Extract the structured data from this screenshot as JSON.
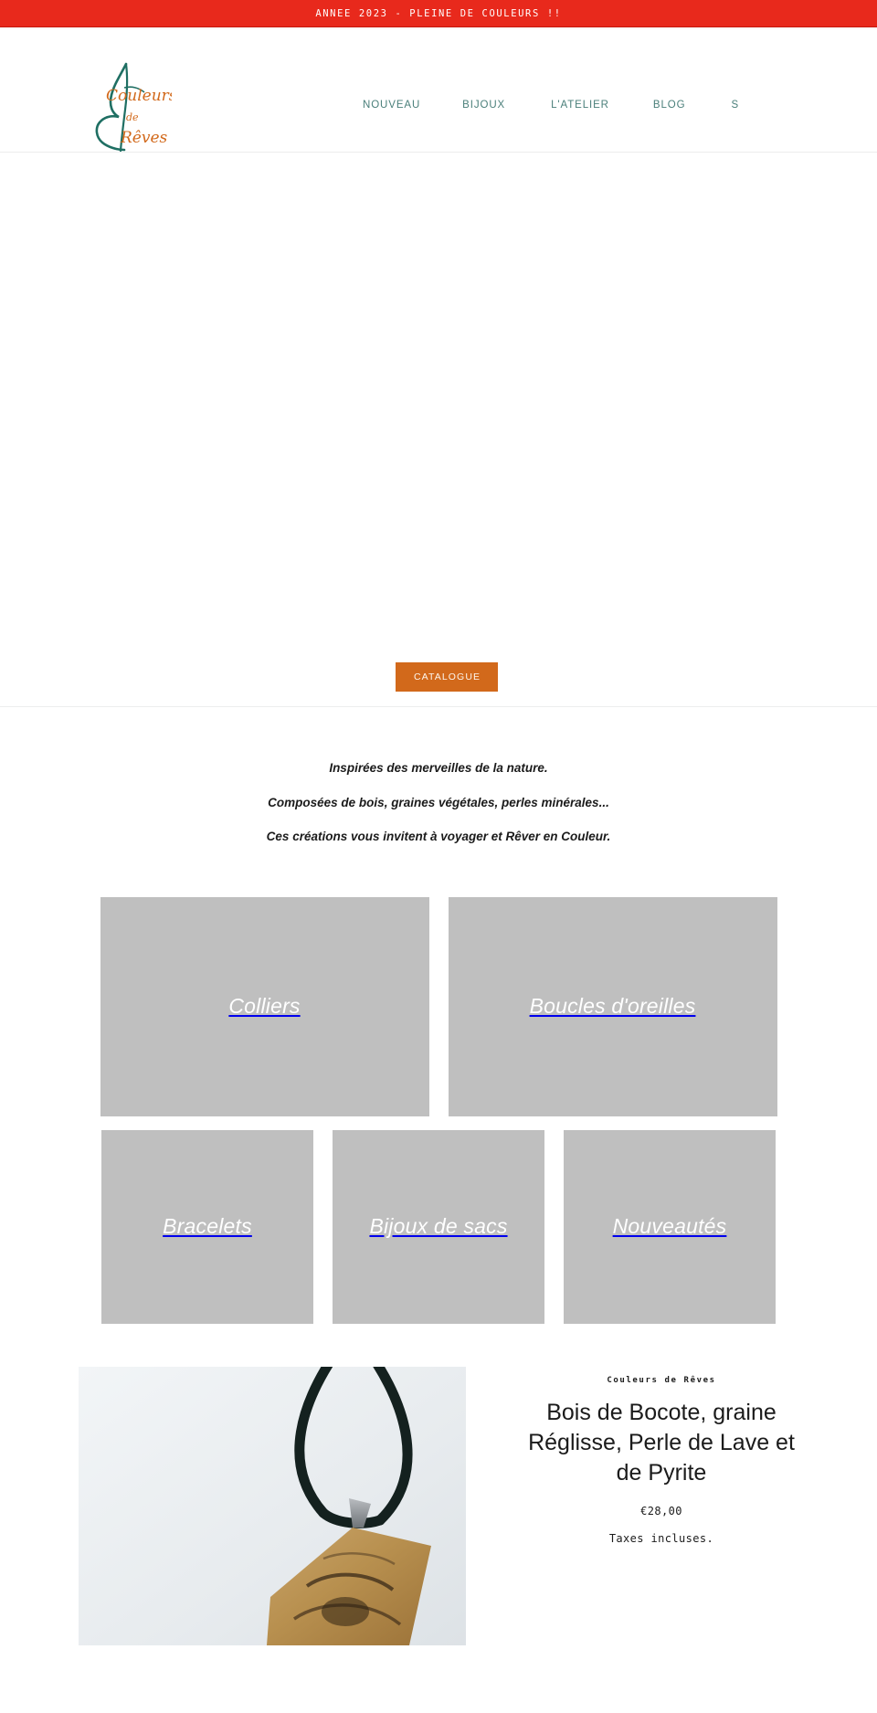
{
  "announcement": {
    "text": "ANNEE 2023 - PLEINE DE COULEURS !!",
    "background": "#e8291c",
    "color": "#ffffff"
  },
  "header": {
    "logo": {
      "name": "couleurs-de-reves-logo",
      "line1": "Couleurs",
      "line2": "de",
      "line3": "Rêves",
      "script_color": "#d2691b",
      "leaf_color": "#1f6f63"
    },
    "nav": {
      "color": "#4a7f7a",
      "items": [
        {
          "label": "NOUVEAU",
          "name": "nav-nouveau"
        },
        {
          "label": "BIJOUX",
          "name": "nav-bijoux"
        },
        {
          "label": "L'ATELIER",
          "name": "nav-atelier"
        },
        {
          "label": "BLOG",
          "name": "nav-blog"
        },
        {
          "label": "S",
          "name": "nav-s"
        }
      ]
    }
  },
  "hero": {
    "button_label": "CATALOGUE",
    "button_color": "#d2691b"
  },
  "intro": {
    "lines": [
      "Inspirées des merveilles de la nature.",
      "Composées de bois, graines végétales, perles minérales...",
      "Ces créations vous invitent à voyager et Rêver en Couleur."
    ]
  },
  "categories": {
    "placeholder_color": "#bfbfbf",
    "row1": [
      {
        "label": "Colliers",
        "name": "category-tile-colliers"
      },
      {
        "label": "Boucles d'oreilles",
        "name": "category-tile-boucles-doreilles"
      }
    ],
    "row2": [
      {
        "label": "Bracelets",
        "name": "category-tile-bracelets"
      },
      {
        "label": "Bijoux de sacs",
        "name": "category-tile-bijoux-de-sacs"
      },
      {
        "label": "Nouveautés",
        "name": "category-tile-nouveautes"
      }
    ]
  },
  "featured_product": {
    "vendor": "Couleurs de Rêves",
    "title": "Bois de Bocote, graine Réglisse, Perle de Lave et de Pyrite",
    "price": "€28,00",
    "tax_note": "Taxes incluses.",
    "image_alt": "collier pendentif bois"
  }
}
